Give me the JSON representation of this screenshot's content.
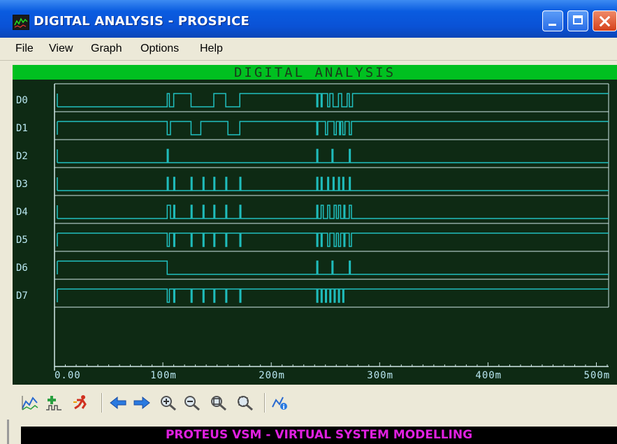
{
  "window": {
    "title": "DIGITAL ANALYSIS - PROSPICE",
    "title_gradient": "#0a52d6",
    "close_color": "#d5411a"
  },
  "menu": {
    "items": [
      "File",
      "View",
      "Graph",
      "Options",
      "Help"
    ]
  },
  "graph": {
    "title": "DIGITAL ANALYSIS",
    "header_color": "#00c020",
    "background_color": "#0e2a14",
    "trace_color": "#20c0c0",
    "frame_color": "#d0e8e8",
    "traces": [
      {
        "name": "D0",
        "initial": 0,
        "transitions": [
          104,
          106,
          110,
          126,
          147,
          158,
          171,
          242,
          243,
          246,
          247,
          252,
          254,
          257,
          262,
          265,
          270,
          272,
          275
        ]
      },
      {
        "name": "D1",
        "initial": 1,
        "transitions": [
          104,
          107,
          126,
          135,
          160,
          171,
          242,
          243,
          250,
          252,
          258,
          260,
          263,
          264,
          266,
          268,
          272,
          274
        ]
      },
      {
        "name": "D2",
        "initial": 0,
        "transitions": [
          104,
          105,
          242,
          243,
          256,
          257,
          272,
          273
        ]
      },
      {
        "name": "D3",
        "initial": 0,
        "transitions": [
          104,
          105,
          110,
          111,
          126,
          127,
          137,
          138,
          147,
          148,
          158,
          159,
          171,
          172,
          242,
          243,
          246,
          247,
          252,
          253,
          257,
          258,
          262,
          263,
          266,
          267,
          272,
          273
        ]
      },
      {
        "name": "D4",
        "initial": 0,
        "transitions": [
          104,
          107,
          110,
          111,
          126,
          127,
          137,
          138,
          147,
          148,
          158,
          159,
          171,
          172,
          242,
          243,
          246,
          248,
          252,
          254,
          258,
          260,
          262,
          264,
          267,
          268,
          272,
          274
        ]
      },
      {
        "name": "D5",
        "initial": 1,
        "transitions": [
          104,
          106,
          110,
          111,
          126,
          127,
          137,
          138,
          147,
          148,
          158,
          159,
          171,
          172,
          242,
          243,
          246,
          247,
          252,
          254,
          258,
          260,
          262,
          264,
          267,
          268,
          272,
          274
        ]
      },
      {
        "name": "D6",
        "initial": 1,
        "transitions": [
          104,
          242,
          243,
          256,
          257,
          272,
          273
        ]
      },
      {
        "name": "D7",
        "initial": 1,
        "transitions": [
          104,
          106,
          110,
          111,
          126,
          127,
          137,
          138,
          147,
          148,
          158,
          159,
          171,
          172,
          242,
          243,
          246,
          247,
          250,
          251,
          254,
          255,
          258,
          259,
          262,
          263,
          266,
          267
        ]
      }
    ],
    "x_ticks": [
      "0.00",
      "100m",
      "200m",
      "300m",
      "400m",
      "500m"
    ],
    "x_range_ms": [
      0,
      510
    ]
  },
  "toolbar": {
    "icons": [
      "graph-edit-icon",
      "add-trace-icon",
      "simulate-icon",
      "pan-left-icon",
      "pan-right-icon",
      "zoom-in-icon",
      "zoom-out-icon",
      "zoom-all-icon",
      "zoom-area-icon",
      "graph-properties-icon"
    ]
  },
  "status": {
    "text": "PROTEUS VSM - VIRTUAL SYSTEM MODELLING",
    "text_color": "#e020e0"
  }
}
